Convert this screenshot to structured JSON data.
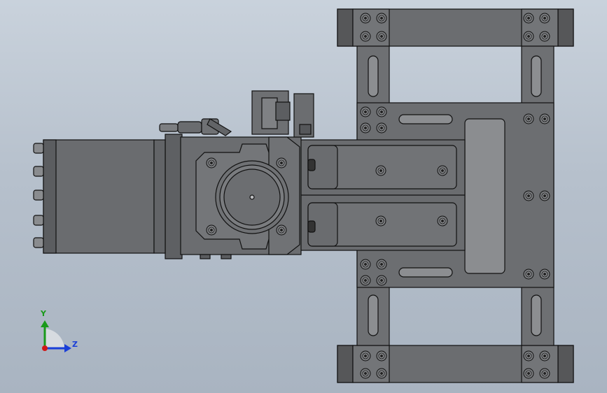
{
  "view": {
    "description_visible": false,
    "background_top": "#c9d2dc",
    "background_bottom": "#a9b4c1"
  },
  "triad": {
    "y_label": "Y",
    "z_label": "Z",
    "y_color": "#1a9a1a",
    "z_color": "#1a3fd8",
    "x_color": "#d01818"
  },
  "model": {
    "part_color": "#6d6f72",
    "edge_color": "#111111"
  }
}
